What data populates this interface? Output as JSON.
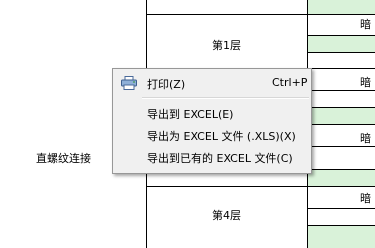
{
  "table": {
    "floor_labels": [
      "第1层",
      "第4层"
    ],
    "row_label": "直螺纹连接",
    "right_snippet": "暗",
    "colors": {
      "grid": "#000000",
      "green_fill": "#d9f2d9",
      "background": "#ffffff"
    }
  },
  "context_menu": {
    "items": [
      {
        "label": "打印(Z)",
        "shortcut": "Ctrl+P",
        "icon": "printer-icon"
      },
      {
        "label": "导出到 EXCEL(E)"
      },
      {
        "label": "导出为 EXCEL 文件 (.XLS)(X)"
      },
      {
        "label": "导出到已有的 EXCEL 文件(C)"
      }
    ],
    "colors": {
      "background": "#f0f0f0",
      "border": "#979797"
    }
  }
}
